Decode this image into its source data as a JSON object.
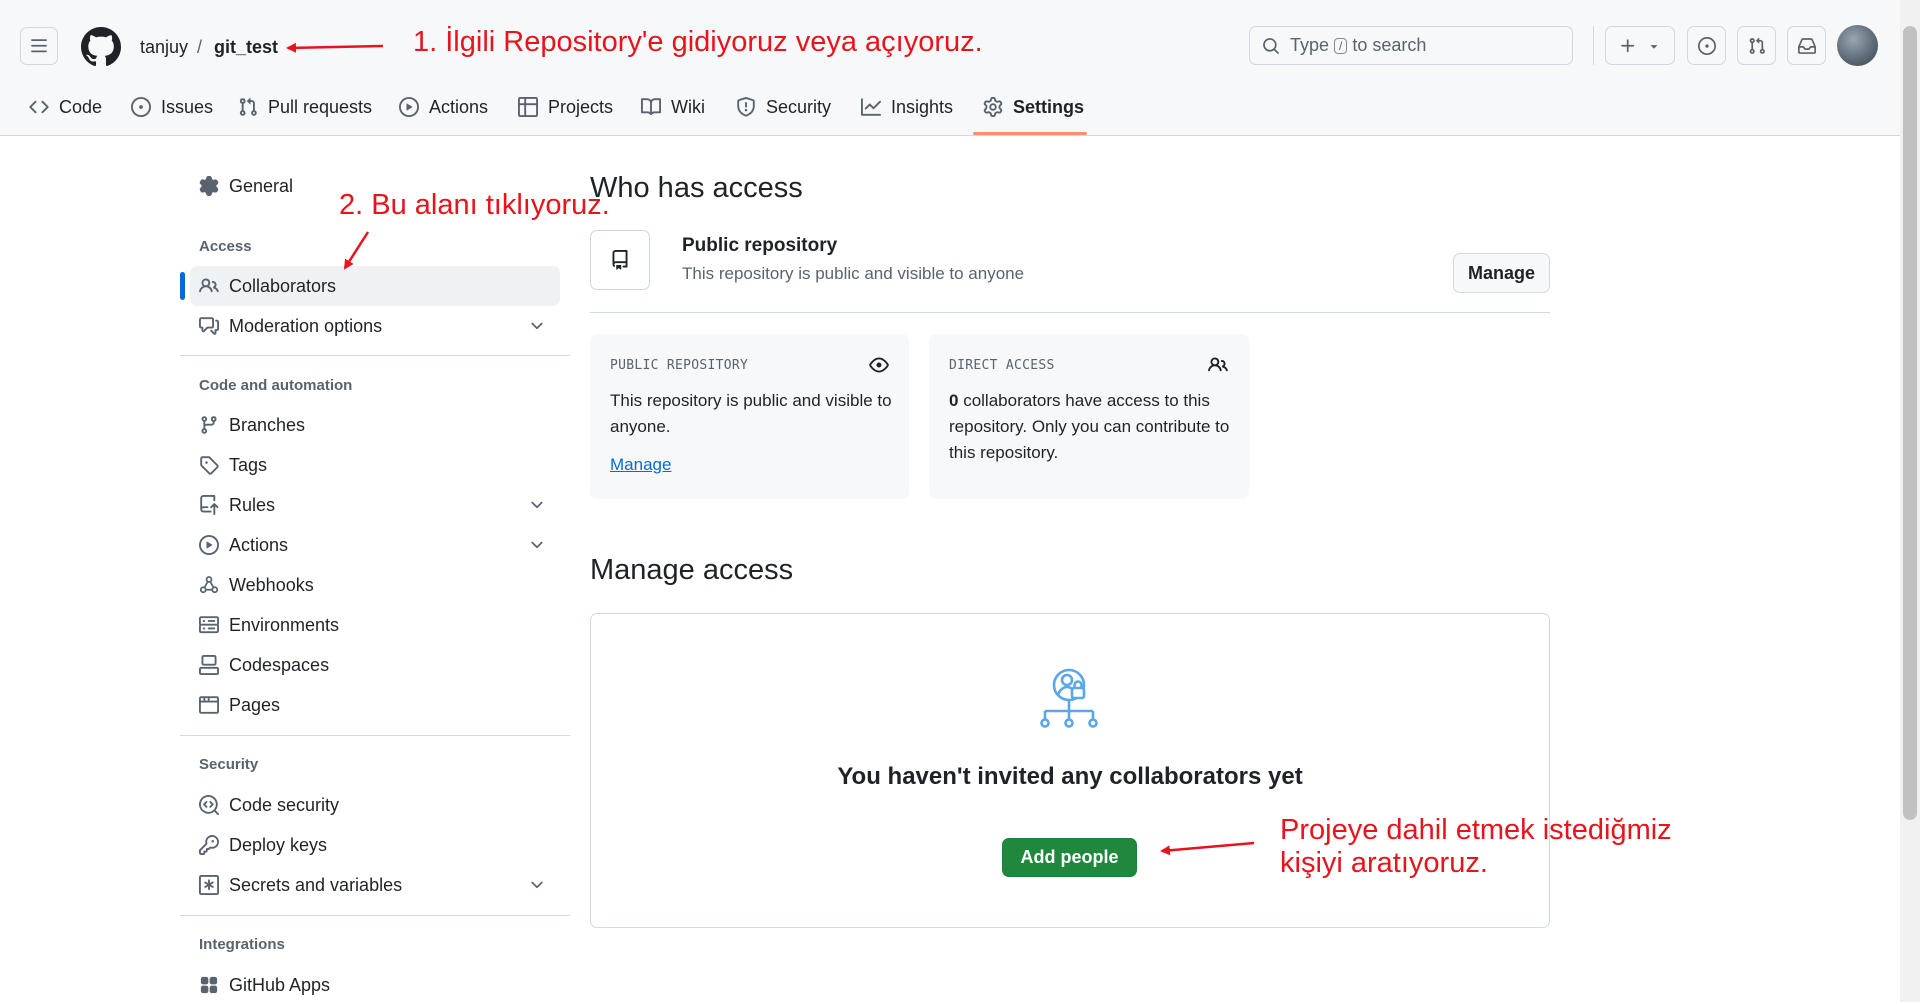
{
  "header": {
    "owner": "tanjuy",
    "separator": "/",
    "repo": "git_test",
    "search_placeholder_prefix": "Type",
    "search_key": "/",
    "search_placeholder_suffix": "to search"
  },
  "tabs": [
    {
      "label": "Code",
      "icon": "code-icon"
    },
    {
      "label": "Issues",
      "icon": "issue-icon"
    },
    {
      "label": "Pull requests",
      "icon": "pull-request-icon"
    },
    {
      "label": "Actions",
      "icon": "play-icon"
    },
    {
      "label": "Projects",
      "icon": "table-icon"
    },
    {
      "label": "Wiki",
      "icon": "book-icon"
    },
    {
      "label": "Security",
      "icon": "shield-icon"
    },
    {
      "label": "Insights",
      "icon": "graph-icon"
    },
    {
      "label": "Settings",
      "icon": "gear-icon"
    }
  ],
  "sidebar": {
    "general": "General",
    "access_heading": "Access",
    "collaborators": "Collaborators",
    "moderation": "Moderation options",
    "code_heading": "Code and automation",
    "code_items": [
      "Branches",
      "Tags",
      "Rules",
      "Actions",
      "Webhooks",
      "Environments",
      "Codespaces",
      "Pages"
    ],
    "security_heading": "Security",
    "security_items": [
      "Code security",
      "Deploy keys",
      "Secrets and variables"
    ],
    "integrations_heading": "Integrations",
    "integrations_items": [
      "GitHub Apps"
    ]
  },
  "main": {
    "who_title": "Who has access",
    "visibility_title": "Public repository",
    "visibility_desc": "This repository is public and visible to anyone",
    "manage_button": "Manage",
    "card_public": {
      "label": "PUBLIC REPOSITORY",
      "text": "This repository is public and visible to anyone.",
      "link": "Manage"
    },
    "card_direct": {
      "label": "DIRECT ACCESS",
      "count": "0",
      "text": "collaborators have access to this repository. Only you can contribute to this repository."
    },
    "manage_access_title": "Manage access",
    "empty_title": "You haven't invited any collaborators yet",
    "add_people": "Add people"
  },
  "annotations": {
    "step1": "1. İlgili Repository'e gidiyoruz veya açıyoruz.",
    "step2": "2. Bu alanı tıklıyoruz.",
    "step3_line1": "Projeye dahil etmek istediğmiz",
    "step3_line2": "kişiyi aratıyoruz."
  },
  "colors": {
    "accent_green": "#1f883d",
    "annotation_red": "#e8141b",
    "tab_underline": "#fd8c73",
    "selected_bar": "#0969da"
  }
}
